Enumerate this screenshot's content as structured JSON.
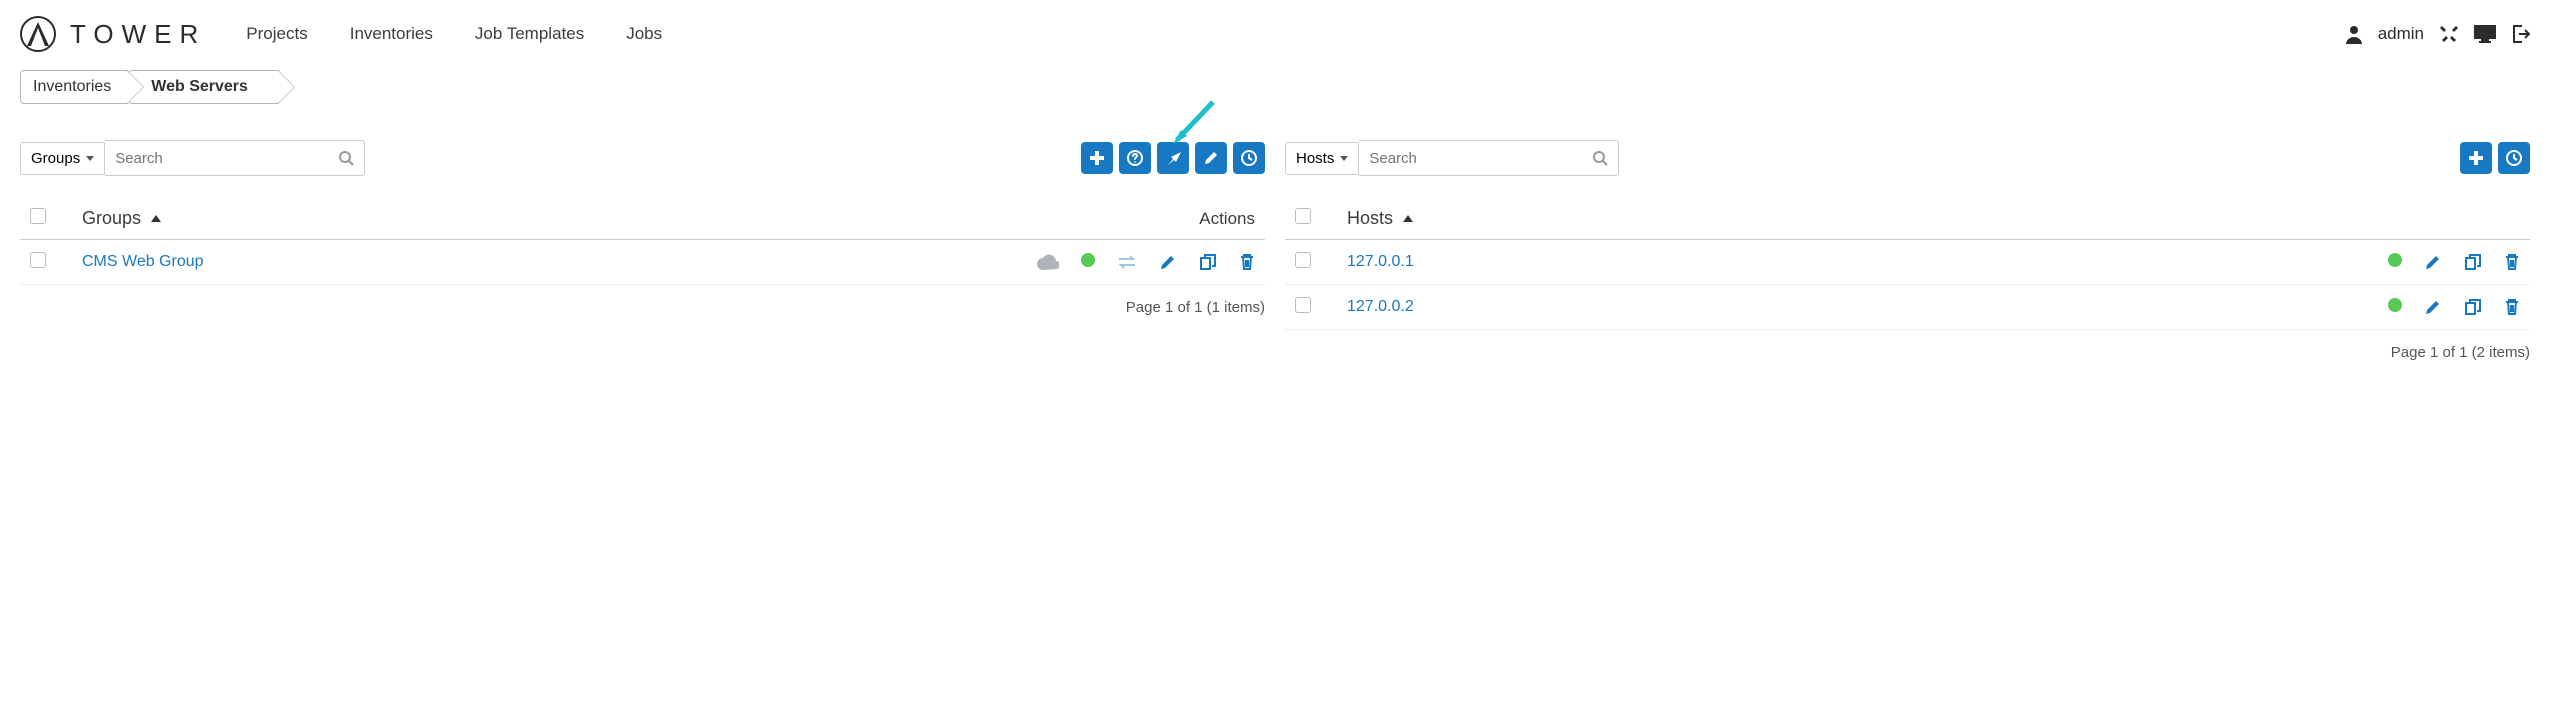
{
  "header": {
    "app_name": "TOWER",
    "logo_letter": "A",
    "nav": {
      "projects": "Projects",
      "inventories": "Inventories",
      "job_templates": "Job Templates",
      "jobs": "Jobs"
    },
    "user": "admin"
  },
  "breadcrumb": {
    "items": [
      "Inventories",
      "Web Servers"
    ]
  },
  "groups_panel": {
    "filter_label": "Groups",
    "search_placeholder": "Search",
    "header_name": "Groups",
    "header_actions": "Actions",
    "rows": [
      {
        "name": "CMS Web Group",
        "status": "ok"
      }
    ],
    "pager": "Page 1 of 1 (1 items)"
  },
  "hosts_panel": {
    "filter_label": "Hosts",
    "search_placeholder": "Search",
    "header_name": "Hosts",
    "rows": [
      {
        "name": "127.0.0.1",
        "status": "ok"
      },
      {
        "name": "127.0.0.2",
        "status": "ok"
      }
    ],
    "pager": "Page 1 of 1 (2 items)"
  },
  "toolbar_icons": {
    "add": "add",
    "help": "help",
    "run": "run",
    "edit": "edit",
    "schedule": "schedule"
  }
}
